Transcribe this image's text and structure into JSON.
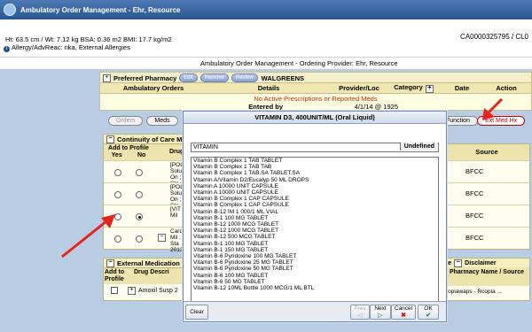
{
  "window": {
    "title": "Ambulatory Order Management - Ehr, Resource"
  },
  "patient": {
    "vitals": "Ht: 63.5 cm / Wt: 7.12 kg   BSA: 0.36 m2  BMI: 17.7 kg/m2",
    "allergies": "Allergy/AdvReac: nka, External Allergies",
    "mrn": "CA0000325795 / CL0"
  },
  "provider_bar": {
    "text": "Ambulatory Order Management - Ordering Provider: Ehr, Resource"
  },
  "preferred_pharmacy": {
    "label": "Preferred Pharmacy",
    "edit": "Edit",
    "remove": "Remove",
    "review": "Review",
    "name": "WALGREENS"
  },
  "orders_table": {
    "headers": [
      "Ambulatory Orders",
      "Details",
      "Provider/Loc",
      "Category",
      "Date",
      "Action"
    ],
    "empty_message": "No Active Prescriptions or Reported Meds",
    "entered_by_label": "Entered by",
    "entered_date": "4/1/14 @ 1925"
  },
  "toolbar": {
    "orders": "Orders",
    "meds": "Meds",
    "function": "Function",
    "ext_med_hx": "Ext Med Hx"
  },
  "continuity": {
    "title": "Continuity of Care M",
    "add_to_profile": "Add to Profile",
    "yes": "Yes",
    "no": "No",
    "drug": "Drug",
    "rows": [
      {
        "text": "[POL Solut 1 On ; Sta",
        "selected": "none"
      },
      {
        "text": "[POL Solut 1 On ; Sta",
        "selected": "none"
      },
      {
        "text": "[VIT 1 Mil",
        "selected": "no"
      },
      {
        "text": "Card 1 Mil ; Sta 2013",
        "selected": "none"
      }
    ],
    "source_header": "Source",
    "sources": [
      "BFCC",
      "BFCC",
      "BFCC",
      "BFCC"
    ]
  },
  "external_meds": {
    "title": "External Medication",
    "add_to_profile": "Add to Profile",
    "drug_desc": "Drug Descri",
    "row_text": "Amoxil Susp 2",
    "right_top": "ite",
    "disclaimer": "Disclaimer",
    "pharmacy_header": "Pharmacy Name / Source",
    "pharmacy_value": "ropiawaps - Rcopia ..."
  },
  "dialog": {
    "title": "VITAMIN D3, 400UNIT/ML (Oral Liquid)",
    "search_value": "VITAMIN",
    "undefined_label": "Undefined",
    "items": [
      "Vitamin B Complex 1 TAB TABLET",
      "Vitamin B Complex 1 TAB TAB",
      "Vitamin B Complex 1 TAB.SA TABLET.SA",
      "Vitamin A/Vitamin D2/Eucalyp 50 ML DROPS",
      "Vitamin A 10000 UNIT CAPSULE",
      "Vitamin A 10000 UNIT CAPSULE",
      "Vitamin B Complex 1 CAP CAPSULE",
      "Vitamin B Complex 1 CAP CAPSULE",
      "Vitamin B-12 IM 1 000/1 ML VIAL",
      "Vitamin B-1 100 MG TABLET",
      "Vitamin B-12 1000 MCG TABLET",
      "Vitamin B-12 1000 MCG TABLET",
      "Vitamin B-12 500 MCG TABLET",
      "Vitamin B-1 100 MG TABLET",
      "Vitamin B-1 150 MG TABLET",
      "Vitamin B-6 Pyridoxine 100 MG TABLET",
      "Vitamin B-6 Pyridoxine 25 MG TABLET",
      "Vitamin B-6 Pyridoxine 50 MG TABLET",
      "Vitamin B-6 100 MG TABLET",
      "Vitamin B-6 50 MG TABLET",
      "Vitamin B-12 10ML Bottle 1000 MCG/1 ML BTL"
    ],
    "clear": "Clear",
    "prev": "Prev",
    "next": "Next",
    "cancel": "Cancel",
    "ok": "OK"
  },
  "colors": {
    "titlebar": "#2c5590",
    "panel": "#b8cde4",
    "annotation_arrow": "#e8231b"
  }
}
